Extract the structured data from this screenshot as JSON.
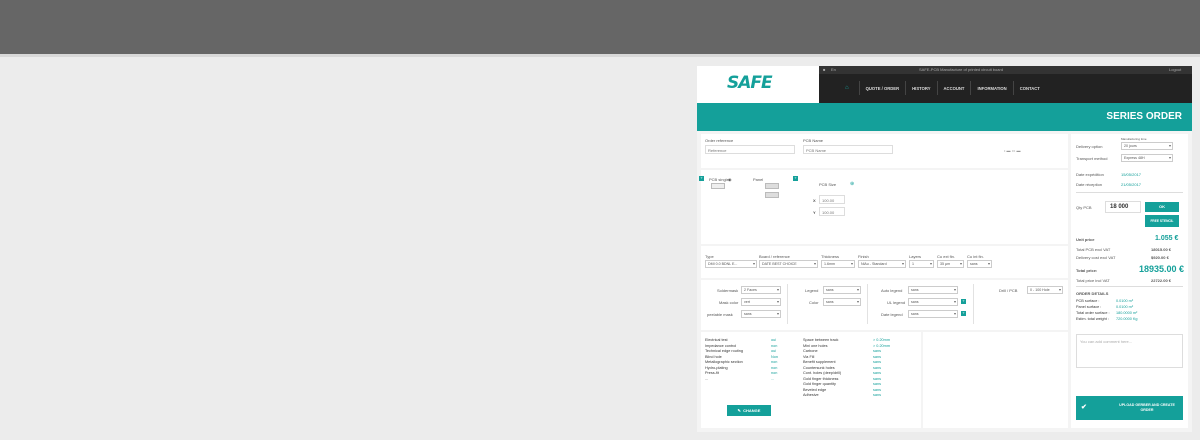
{
  "app": {
    "logo": "SAFE"
  },
  "navtop": {
    "lang": "En",
    "site_title": "SAFE-PCB Manufacture of printed circuit board",
    "logout": "Logout"
  },
  "nav": {
    "home_icon": "⌂",
    "items": [
      "QUOTE / ORDER",
      "HISTORY",
      "ACCOUNT",
      "INFORMATION",
      "CONTACT"
    ]
  },
  "banner": {
    "title": "SERIES ORDER"
  },
  "form": {
    "order_ref_label": "Order reference",
    "order_ref_value": "Reference",
    "pcb_name_label": "PCB Name",
    "pcb_name_value": "PCB Name",
    "pcb_single_label": "PCB single",
    "panel_label": "Panel",
    "pcb_size_label": "PCB Size",
    "x_label": "X",
    "y_label": "Y",
    "x_value": "100.00",
    "y_value": "100.00"
  },
  "specs": {
    "headers": [
      "Type",
      "Board / reference",
      "Thickness",
      "Finish",
      "Layers",
      "Cu ext fin.",
      "Cu int fin."
    ],
    "values": [
      "DMI 0.0 BDNL E...",
      "DATE BEST CHOICE",
      "1.6mm",
      "NiAu - Standard",
      "1",
      "35 µm",
      "sans"
    ]
  },
  "mask": {
    "soldermask_label": "Soldermask",
    "soldermask_value": "2 Faces",
    "mask_color_label": "Mask color",
    "mask_color_value": "vert",
    "peelable_label": "peelable mask",
    "peelable_value": "sans",
    "legend_label": "Legend",
    "legend_value": "sans",
    "color_label": "Color",
    "color_value": "sans",
    "auto_legend_label": "Auto legend",
    "auto_legend_value": "sans",
    "ul_legend_label": "UL legend",
    "ul_legend_value": "sans",
    "date_legend_label": "Date legend",
    "date_legend_value": "sans",
    "drill_label": "Drill / PCB",
    "drill_value": "0 - 100 Hole"
  },
  "options": {
    "left": [
      [
        "Electrical test",
        "oui"
      ],
      [
        "Impedance control",
        "non"
      ],
      [
        "Technical edge routing",
        "oui"
      ],
      [
        "Blind hole",
        "Non"
      ],
      [
        "Metallographic section",
        "non"
      ],
      [
        "Hydro-plating",
        "non"
      ],
      [
        "Press-fit",
        "non"
      ],
      [
        "...",
        "..."
      ]
    ],
    "right": [
      [
        "Space between track",
        "> 0.20mm"
      ],
      [
        "Mini one holes",
        "> 0.20mm"
      ],
      [
        "Carbone",
        "sans"
      ],
      [
        "Via Fill",
        "sans"
      ],
      [
        "Benefit supplement",
        "sans"
      ],
      [
        "Countersunk holes",
        "sans"
      ],
      [
        "Cont. holes (deep/drill)",
        "sans"
      ],
      [
        "Gold finger thickness",
        "sans"
      ],
      [
        "Gold finger quantity",
        "sans"
      ],
      [
        "Beveled edge",
        "sans"
      ],
      [
        "Adhesive",
        "sans"
      ]
    ],
    "change_label": "CHANGE"
  },
  "side": {
    "manufacturing_time_label": "Manufacturing time",
    "delivery_label": "Delivery option",
    "delivery_value": "20 jours",
    "transport_label": "Transport method",
    "transport_value": "Express 48H",
    "date_exp_label": "Date expédition",
    "date_exp_value": "15/05/2017",
    "date_rec_label": "Date réception",
    "date_rec_value": "21/05/2017",
    "qty_label": "Qty PCB",
    "qty_value": "18 000",
    "ok_label": "OK",
    "free_stencil_label": "FREE STENCIL",
    "unit_price_label": "Unit price",
    "unit_price_value": "1.055 €",
    "total_pcb_label": "Total PCB excl VAT",
    "total_pcb_value": "18015.00 €",
    "delivery_cost_label": "Delivery cost excl VAT",
    "delivery_cost_value": "$920.00 €",
    "total_price_label": "Total price:",
    "total_price_value": "18935.00 €",
    "total_incl_label": "Total price incl VAT",
    "total_incl_value": "22722.00 €",
    "order_details_label": "ORDER DETAILS",
    "details": [
      [
        "PCB surface :",
        "0.0100 m²"
      ],
      [
        "Panel surface :",
        "0.0100 m²"
      ],
      [
        "Total order surface :",
        "180.0000 m²"
      ],
      [
        "Estim. total weight :",
        "720.0000 Kg"
      ]
    ],
    "comment_placeholder": "You can add comment here...",
    "cta_label": "UPLOAD GERBER AND CREATE ORDER"
  }
}
